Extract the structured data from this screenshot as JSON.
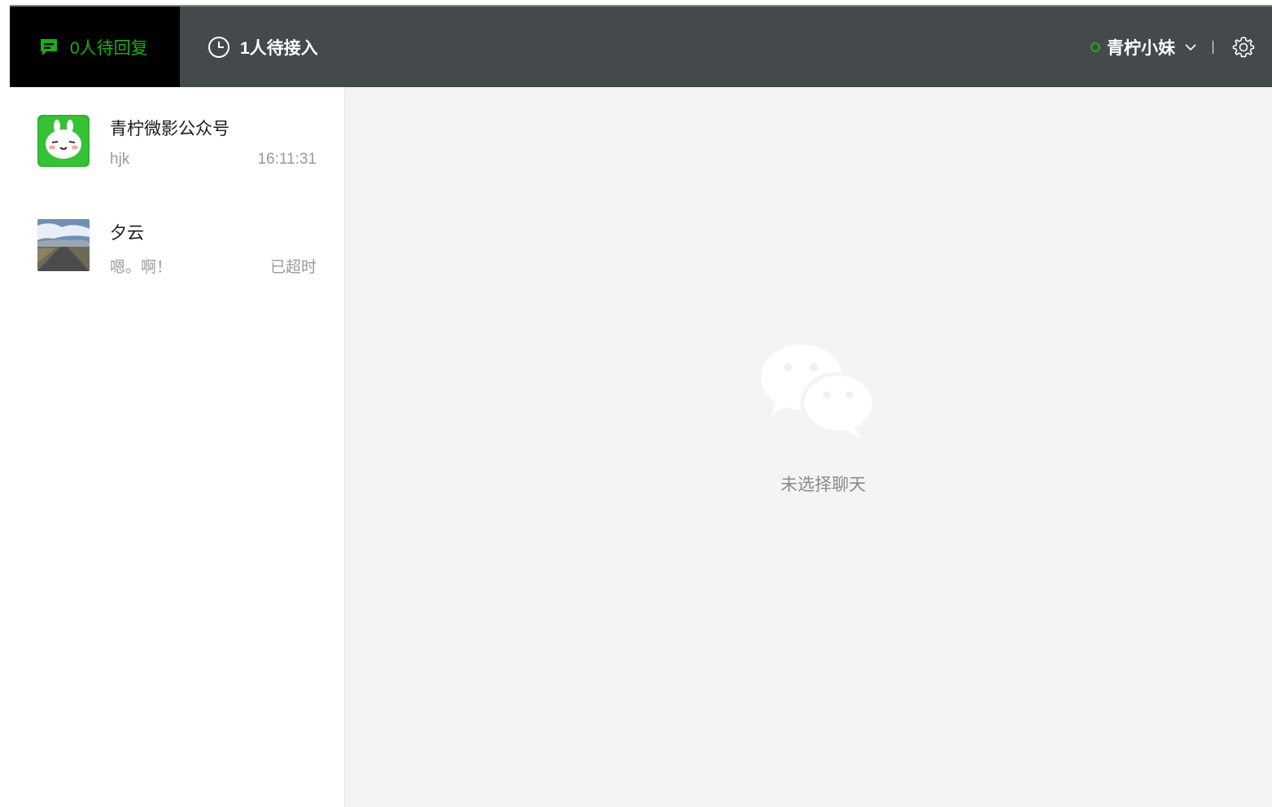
{
  "topbar": {
    "tab_reply_label": "0人待回复",
    "tab_waiting_label": "1人待接入",
    "account_name": "青柠小妹",
    "colors": {
      "accent": "#1aad19",
      "bar": "#444a4b",
      "active_tab": "#000000"
    }
  },
  "conversations": [
    {
      "name": "青柠微影公众号",
      "preview": "hjk",
      "meta": "16:11:31",
      "avatar": "green-bunny-avatar"
    },
    {
      "name": "夕云",
      "preview": "嗯。啊！",
      "meta": "已超时",
      "avatar": "road-landscape-avatar"
    }
  ],
  "main": {
    "empty_text": "未选择聊天",
    "empty_icon": "wechat-logo-icon"
  }
}
